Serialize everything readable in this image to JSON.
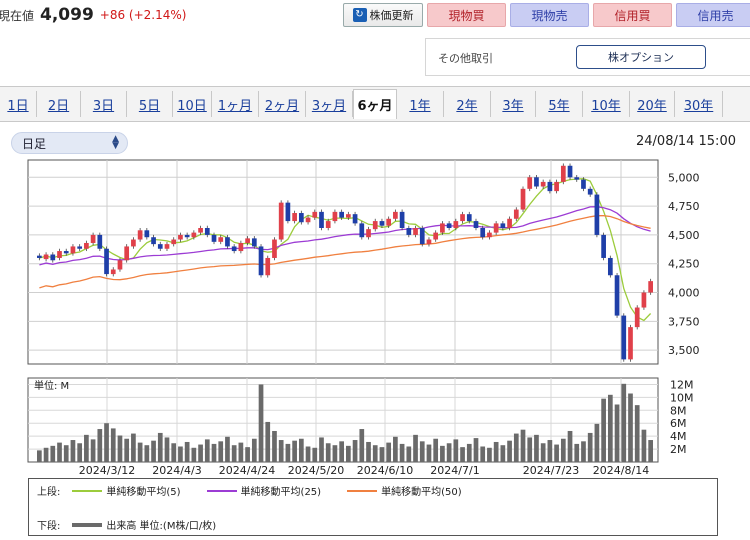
{
  "price": {
    "label": "現在値",
    "value": "4,099",
    "change": "+86 (+2.14%)"
  },
  "buttons": {
    "refresh": "株価更新",
    "cash_buy": "現物買",
    "cash_sell": "現物売",
    "margin_buy": "信用買",
    "margin_sell": "信用売"
  },
  "other": {
    "label": "その他取引",
    "option": "株オプション"
  },
  "tabs": [
    "1日",
    "2日",
    "3日",
    "5日",
    "10日",
    "1ヶ月",
    "2ヶ月",
    "3ヶ月",
    "6ヶ月",
    "1年",
    "2年",
    "3年",
    "5年",
    "10年",
    "20年",
    "30年"
  ],
  "active_tab": "6ヶ月",
  "period_select": "日足",
  "timestamp": "24/08/14 15:00",
  "colors": {
    "up": "#e0404a",
    "down": "#1f3fa8",
    "ma5": "#9ccc3c",
    "ma25": "#9c3cd4",
    "ma50": "#f08040",
    "volume": "#6a6a6a"
  },
  "chart_data": {
    "type": "candlestick",
    "x_ticks": [
      "2024/3/12",
      "2024/4/3",
      "2024/4/24",
      "2024/5/20",
      "2024/6/10",
      "2024/7/1",
      "2024/7/23",
      "2024/8/14"
    ],
    "price_ticks": [
      "5,000",
      "4,750",
      "4,500",
      "4,250",
      "4,000",
      "3,750",
      "3,500"
    ],
    "price_range": [
      3380,
      5150
    ],
    "volume_unit_label": "単位: M",
    "volume_ticks": [
      "12M",
      "10M",
      "8M",
      "6M",
      "4M",
      "2M"
    ],
    "volume_range": [
      0,
      13
    ],
    "candles": [
      [
        4320,
        4300
      ],
      [
        4290,
        4330
      ],
      [
        4330,
        4280
      ],
      [
        4300,
        4360
      ],
      [
        4360,
        4340
      ],
      [
        4340,
        4400
      ],
      [
        4400,
        4380
      ],
      [
        4380,
        4430
      ],
      [
        4430,
        4500
      ],
      [
        4500,
        4380
      ],
      [
        4380,
        4160
      ],
      [
        4160,
        4200
      ],
      [
        4200,
        4280
      ],
      [
        4280,
        4400
      ],
      [
        4400,
        4460
      ],
      [
        4460,
        4540
      ],
      [
        4540,
        4480
      ],
      [
        4480,
        4420
      ],
      [
        4420,
        4380
      ],
      [
        4380,
        4420
      ],
      [
        4420,
        4460
      ],
      [
        4460,
        4500
      ],
      [
        4500,
        4480
      ],
      [
        4480,
        4520
      ],
      [
        4520,
        4560
      ],
      [
        4560,
        4500
      ],
      [
        4500,
        4440
      ],
      [
        4440,
        4480
      ],
      [
        4480,
        4400
      ],
      [
        4400,
        4360
      ],
      [
        4360,
        4430
      ],
      [
        4430,
        4470
      ],
      [
        4470,
        4400
      ],
      [
        4400,
        4150
      ],
      [
        4150,
        4300
      ],
      [
        4300,
        4460
      ],
      [
        4460,
        4780
      ],
      [
        4780,
        4620
      ],
      [
        4620,
        4690
      ],
      [
        4690,
        4610
      ],
      [
        4610,
        4650
      ],
      [
        4650,
        4700
      ],
      [
        4700,
        4560
      ],
      [
        4560,
        4620
      ],
      [
        4620,
        4700
      ],
      [
        4700,
        4650
      ],
      [
        4650,
        4680
      ],
      [
        4680,
        4600
      ],
      [
        4600,
        4480
      ],
      [
        4480,
        4550
      ],
      [
        4550,
        4620
      ],
      [
        4620,
        4580
      ],
      [
        4580,
        4640
      ],
      [
        4640,
        4700
      ],
      [
        4700,
        4560
      ],
      [
        4560,
        4500
      ],
      [
        4500,
        4560
      ],
      [
        4560,
        4420
      ],
      [
        4420,
        4460
      ],
      [
        4460,
        4520
      ],
      [
        4520,
        4600
      ],
      [
        4600,
        4560
      ],
      [
        4560,
        4620
      ],
      [
        4620,
        4680
      ],
      [
        4680,
        4620
      ],
      [
        4620,
        4560
      ],
      [
        4560,
        4480
      ],
      [
        4480,
        4520
      ],
      [
        4520,
        4600
      ],
      [
        4600,
        4560
      ],
      [
        4560,
        4640
      ],
      [
        4640,
        4720
      ],
      [
        4720,
        4900
      ],
      [
        4900,
        5000
      ],
      [
        5000,
        4920
      ],
      [
        4920,
        4960
      ],
      [
        4960,
        4880
      ],
      [
        4880,
        4960
      ],
      [
        4960,
        5100
      ],
      [
        5100,
        5000
      ],
      [
        5000,
        4980
      ],
      [
        4980,
        4900
      ],
      [
        4900,
        4850
      ],
      [
        4850,
        4500
      ],
      [
        4500,
        4300
      ],
      [
        4300,
        4150
      ],
      [
        4150,
        3800
      ],
      [
        3800,
        3420
      ],
      [
        3420,
        3700
      ],
      [
        3700,
        3870
      ],
      [
        3870,
        4000
      ],
      [
        4000,
        4099
      ]
    ],
    "volume": [
      1.8,
      2.2,
      2.5,
      3.0,
      2.6,
      3.4,
      2.9,
      4.2,
      3.5,
      5.1,
      6.0,
      5.2,
      4.1,
      3.6,
      4.4,
      3.0,
      2.6,
      3.3,
      4.5,
      3.8,
      2.9,
      2.4,
      3.1,
      2.2,
      2.7,
      3.5,
      2.8,
      3.2,
      3.9,
      2.6,
      3.0,
      2.3,
      3.6,
      12.0,
      6.2,
      4.8,
      3.4,
      2.8,
      3.3,
      3.6,
      2.4,
      2.2,
      3.8,
      2.9,
      2.6,
      3.2,
      2.5,
      3.4,
      5.1,
      3.1,
      2.6,
      2.3,
      3.0,
      3.9,
      2.8,
      2.4,
      4.2,
      3.2,
      2.7,
      3.6,
      2.5,
      2.9,
      3.5,
      2.3,
      2.8,
      3.7,
      2.4,
      2.2,
      3.1,
      2.6,
      3.3,
      4.4,
      5.0,
      3.8,
      4.2,
      2.9,
      3.4,
      2.7,
      3.6,
      4.8,
      2.8,
      3.2,
      4.5,
      5.9,
      9.8,
      10.4,
      8.9,
      12.1,
      10.6,
      8.8,
      5.0,
      3.4
    ]
  },
  "legend": {
    "upper_label": "上段:",
    "lower_label": "下段:",
    "ma5": "単純移動平均(5)",
    "ma25": "単純移動平均(25)",
    "ma50": "単純移動平均(50)",
    "volume": "出来高 単位:(M株/口/枚)"
  }
}
